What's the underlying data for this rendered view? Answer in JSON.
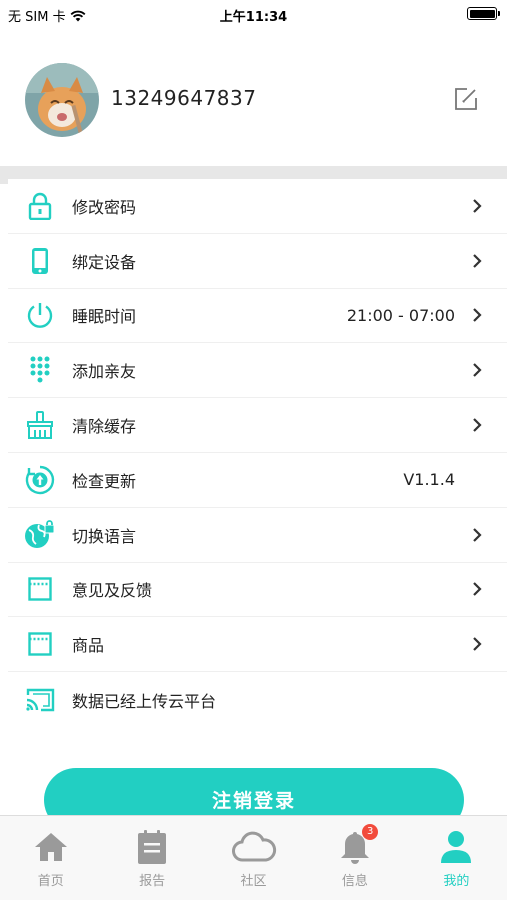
{
  "status_bar": {
    "carrier": "无 SIM 卡",
    "time": "上午11:34"
  },
  "profile": {
    "phone": "13249647837"
  },
  "settings": [
    {
      "label": "修改密码",
      "value": "",
      "icon": "lock-icon",
      "chevron": true
    },
    {
      "label": "绑定设备",
      "value": "",
      "icon": "phone-device-icon",
      "chevron": true
    },
    {
      "label": "睡眠时间",
      "value": "21:00 - 07:00",
      "icon": "power-icon",
      "chevron": true
    },
    {
      "label": "添加亲友",
      "value": "",
      "icon": "dialpad-icon",
      "chevron": true
    },
    {
      "label": "清除缓存",
      "value": "",
      "icon": "broom-icon",
      "chevron": true
    },
    {
      "label": "检查更新",
      "value": "V1.1.4",
      "icon": "upload-circle-icon",
      "chevron": false
    },
    {
      "label": "切换语言",
      "value": "",
      "icon": "globe-lock-icon",
      "chevron": true
    },
    {
      "label": "意见及反馈",
      "value": "",
      "icon": "window-icon",
      "chevron": true
    },
    {
      "label": "商品",
      "value": "",
      "icon": "window-icon",
      "chevron": true
    },
    {
      "label": "数据已经上传云平台",
      "value": "",
      "icon": "cast-icon",
      "chevron": false
    }
  ],
  "logout_label": "注销登录",
  "tabs": [
    {
      "label": "首页",
      "icon": "home-icon",
      "active": false
    },
    {
      "label": "报告",
      "icon": "report-icon",
      "active": false
    },
    {
      "label": "社区",
      "icon": "cloud-icon",
      "active": false
    },
    {
      "label": "信息",
      "icon": "bell-icon",
      "active": false,
      "badge": "3"
    },
    {
      "label": "我的",
      "icon": "person-icon",
      "active": true
    }
  ],
  "colors": {
    "accent": "#22cfc2",
    "inactive": "#9a9a9a",
    "badge": "#f24b3c"
  }
}
